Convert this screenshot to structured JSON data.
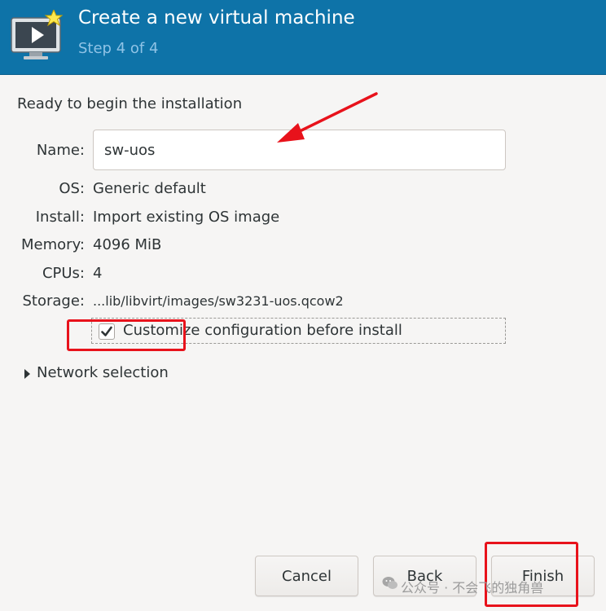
{
  "header": {
    "title": "Create a new virtual machine",
    "subtitle": "Step 4 of 4",
    "icon": "vm-new-icon"
  },
  "summary": {
    "heading": "Ready to begin the installation",
    "name_label": "Name:",
    "name_value": "sw-uos",
    "os_label": "OS:",
    "os_value": "Generic default",
    "install_label": "Install:",
    "install_value": "Import existing OS image",
    "memory_label": "Memory:",
    "memory_value": "4096 MiB",
    "cpus_label": "CPUs:",
    "cpus_value": "4",
    "storage_label": "Storage:",
    "storage_value": "...lib/libvirt/images/sw3231-uos.qcow2"
  },
  "customize": {
    "label": "Customize configuration before install",
    "checked": true
  },
  "network": {
    "label": "Network selection",
    "expanded": false
  },
  "buttons": {
    "cancel": "Cancel",
    "back": "Back",
    "finish": "Finish"
  },
  "watermark": {
    "text": "公众号 · 不会飞的独角兽"
  },
  "colors": {
    "header_bg": "#0e73a8",
    "annotation_red": "#e8121b"
  }
}
